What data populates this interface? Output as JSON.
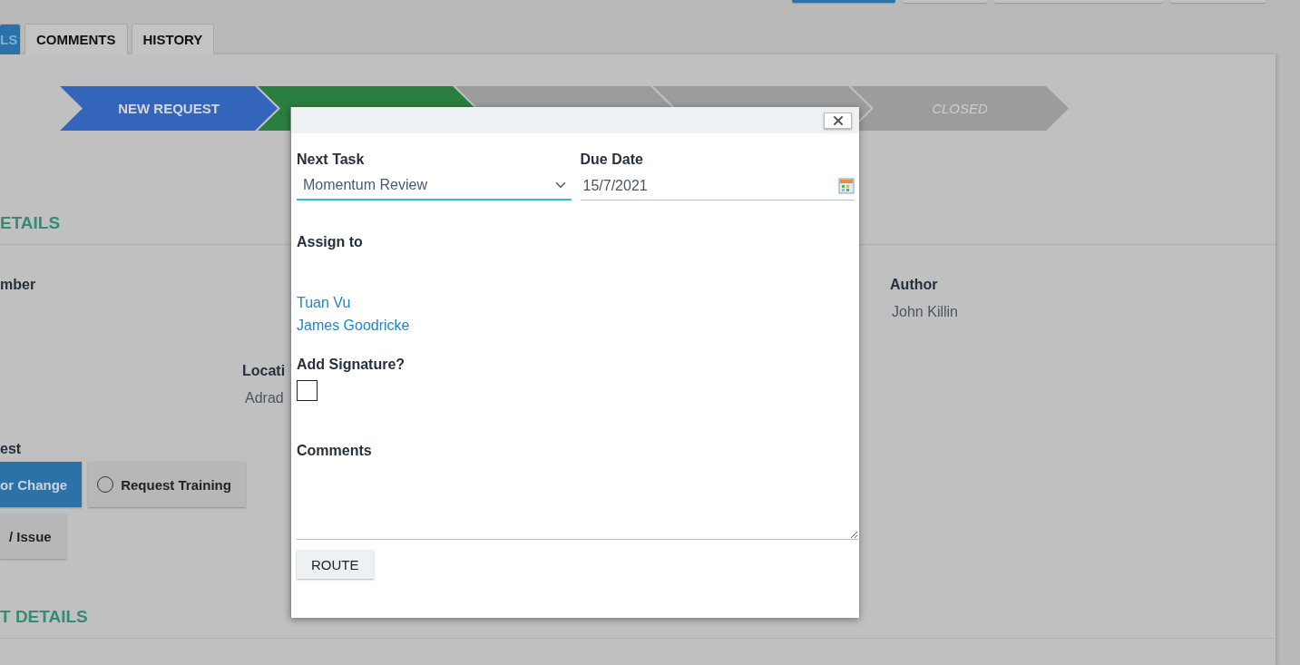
{
  "toolbar_buttons": [
    {
      "color": "#2a72a8"
    },
    {
      "color": "#c4c4c4"
    },
    {
      "color": "#c4c4c4"
    },
    {
      "color": "#c4c4c4"
    }
  ],
  "tabs": [
    {
      "label": "LS",
      "selected": true
    },
    {
      "label": "COMMENTS",
      "selected": false
    },
    {
      "label": "HISTORY",
      "selected": false
    }
  ],
  "stages": [
    {
      "label": "NEW REQUEST",
      "kind": "done"
    },
    {
      "kind": "current"
    },
    {
      "kind": "pending"
    },
    {
      "kind": "pending"
    },
    {
      "label": "CLOSED",
      "kind": "pending"
    }
  ],
  "details": {
    "heading": "ETAILS",
    "number_label": "mber",
    "location_label": "Locati",
    "location_value": "Adrad",
    "author_label": "Author",
    "author_value": "John Killin",
    "request_label": "est",
    "request_options": [
      {
        "label": "or Change",
        "selected": true,
        "kind": "clipped"
      },
      {
        "label": "Request Training",
        "selected": false,
        "kind": "full"
      },
      {
        "label": "/ Issue",
        "selected": false,
        "kind": "clipped"
      }
    ]
  },
  "request_details": {
    "heading": "T DETAILS"
  },
  "dialog": {
    "next_task_label": "Next Task",
    "next_task_value": "Momentum Review",
    "due_date_label": "Due Date",
    "due_date_value": "15/7/2021",
    "assign_label": "Assign to",
    "assignees": [
      "Tuan Vu",
      "James Goodricke"
    ],
    "signature_label": "Add Signature?",
    "signature_checked": false,
    "comments_label": "Comments",
    "route_button": "ROUTE"
  }
}
